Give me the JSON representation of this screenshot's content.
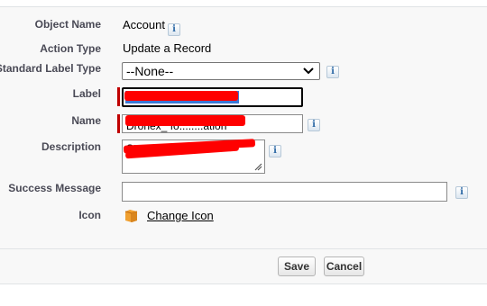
{
  "fields": {
    "object_name": {
      "label": "Object Name",
      "value": "Account"
    },
    "action_type": {
      "label": "Action Type",
      "value": "Update a Record"
    },
    "standard_label_type": {
      "label": "Standard Label Type",
      "value": "--None--"
    },
    "label": {
      "label": "Label"
    },
    "name": {
      "label": "Name",
      "value": "Dronex_ fo........ation"
    },
    "description": {
      "label": "Description",
      "value": "Standard ..."
    },
    "success_message": {
      "label": "Success Message",
      "value": ""
    },
    "icon": {
      "label": "Icon",
      "link": "Change Icon"
    }
  },
  "info_glyph": "i",
  "buttons": {
    "save": "Save",
    "cancel": "Cancel"
  },
  "colors": {
    "required": "#c00000",
    "redaction": "#ff0000",
    "info": "#2f6aa6"
  },
  "icons": {
    "info": "info-icon",
    "select": "chevron-down-icon",
    "resize": "resize-handle-icon",
    "object": "puzzle-piece-icon"
  }
}
